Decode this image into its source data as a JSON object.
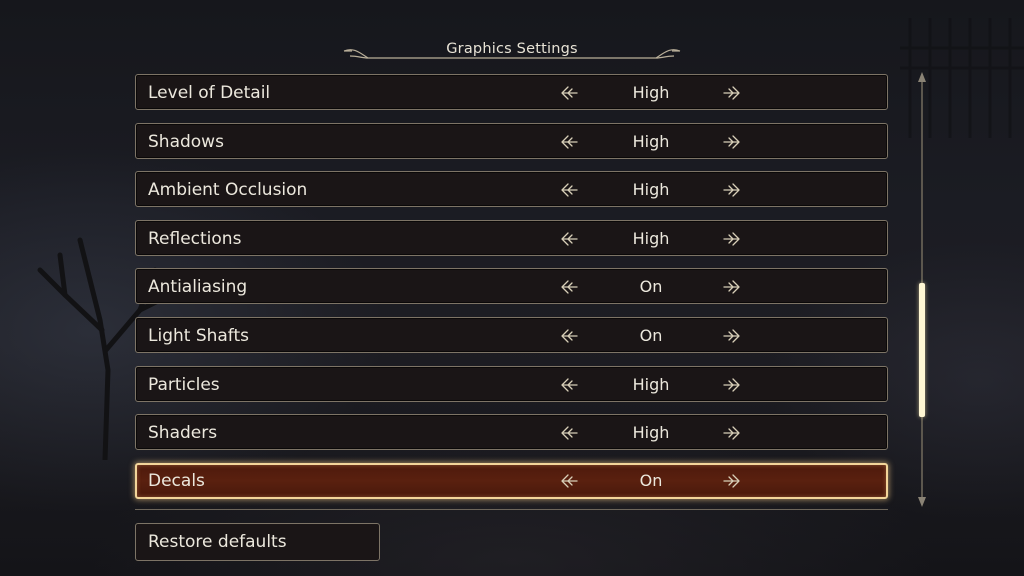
{
  "header": {
    "title": "Graphics Settings"
  },
  "settings": [
    {
      "label": "Level of Detail",
      "value": "High"
    },
    {
      "label": "Shadows",
      "value": "High"
    },
    {
      "label": "Ambient Occlusion",
      "value": "High"
    },
    {
      "label": "Reflections",
      "value": "High"
    },
    {
      "label": "Antialiasing",
      "value": "On"
    },
    {
      "label": "Light Shafts",
      "value": "On"
    },
    {
      "label": "Particles",
      "value": "High"
    },
    {
      "label": "Shaders",
      "value": "High"
    },
    {
      "label": "Decals",
      "value": "On",
      "selected": true
    }
  ],
  "restore": {
    "label": "Restore defaults"
  },
  "scrollbar": {
    "visible_fraction": 0.32,
    "position_fraction": 0.65
  },
  "colors": {
    "text": "#ece8dd",
    "border": "#7d7466",
    "selected_fill": "#5a200f",
    "selected_border": "#f3d59a",
    "scroll_thumb": "#fff7d4"
  },
  "icons": {
    "left": "arrow-left-icon",
    "right": "arrow-right-icon"
  }
}
